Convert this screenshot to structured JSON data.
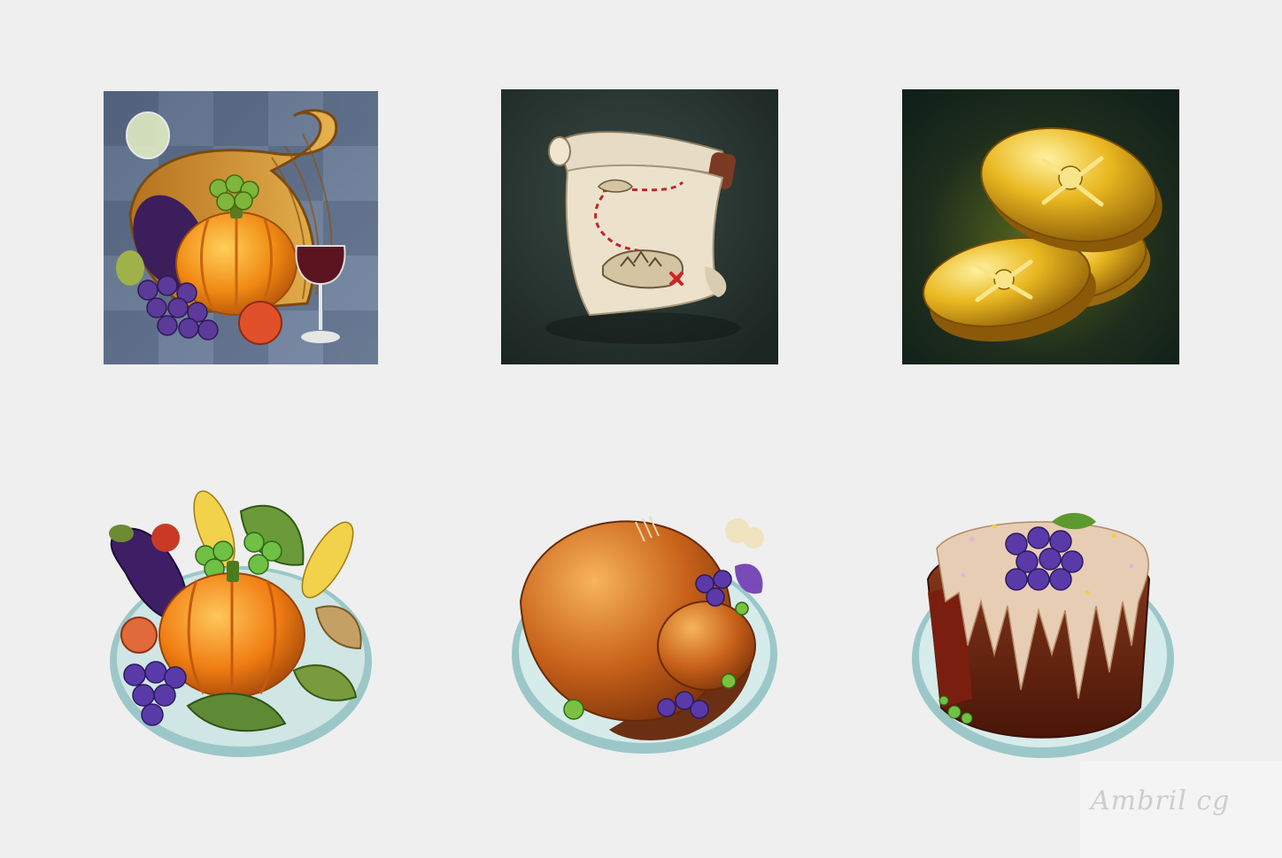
{
  "gallery": {
    "background": "#efefef",
    "items": [
      {
        "id": "cornucopia",
        "icon": "cornucopia-icon"
      },
      {
        "id": "treasure-map",
        "icon": "treasure-map-icon"
      },
      {
        "id": "pirate-coins",
        "icon": "pirate-coins-icon"
      },
      {
        "id": "vegetable-platter",
        "icon": "vegetable-platter-icon"
      },
      {
        "id": "roast-turkey",
        "icon": "roast-turkey-icon"
      },
      {
        "id": "grape-cake",
        "icon": "grape-cake-icon"
      }
    ]
  },
  "watermark": {
    "text": "Ambril cg"
  }
}
